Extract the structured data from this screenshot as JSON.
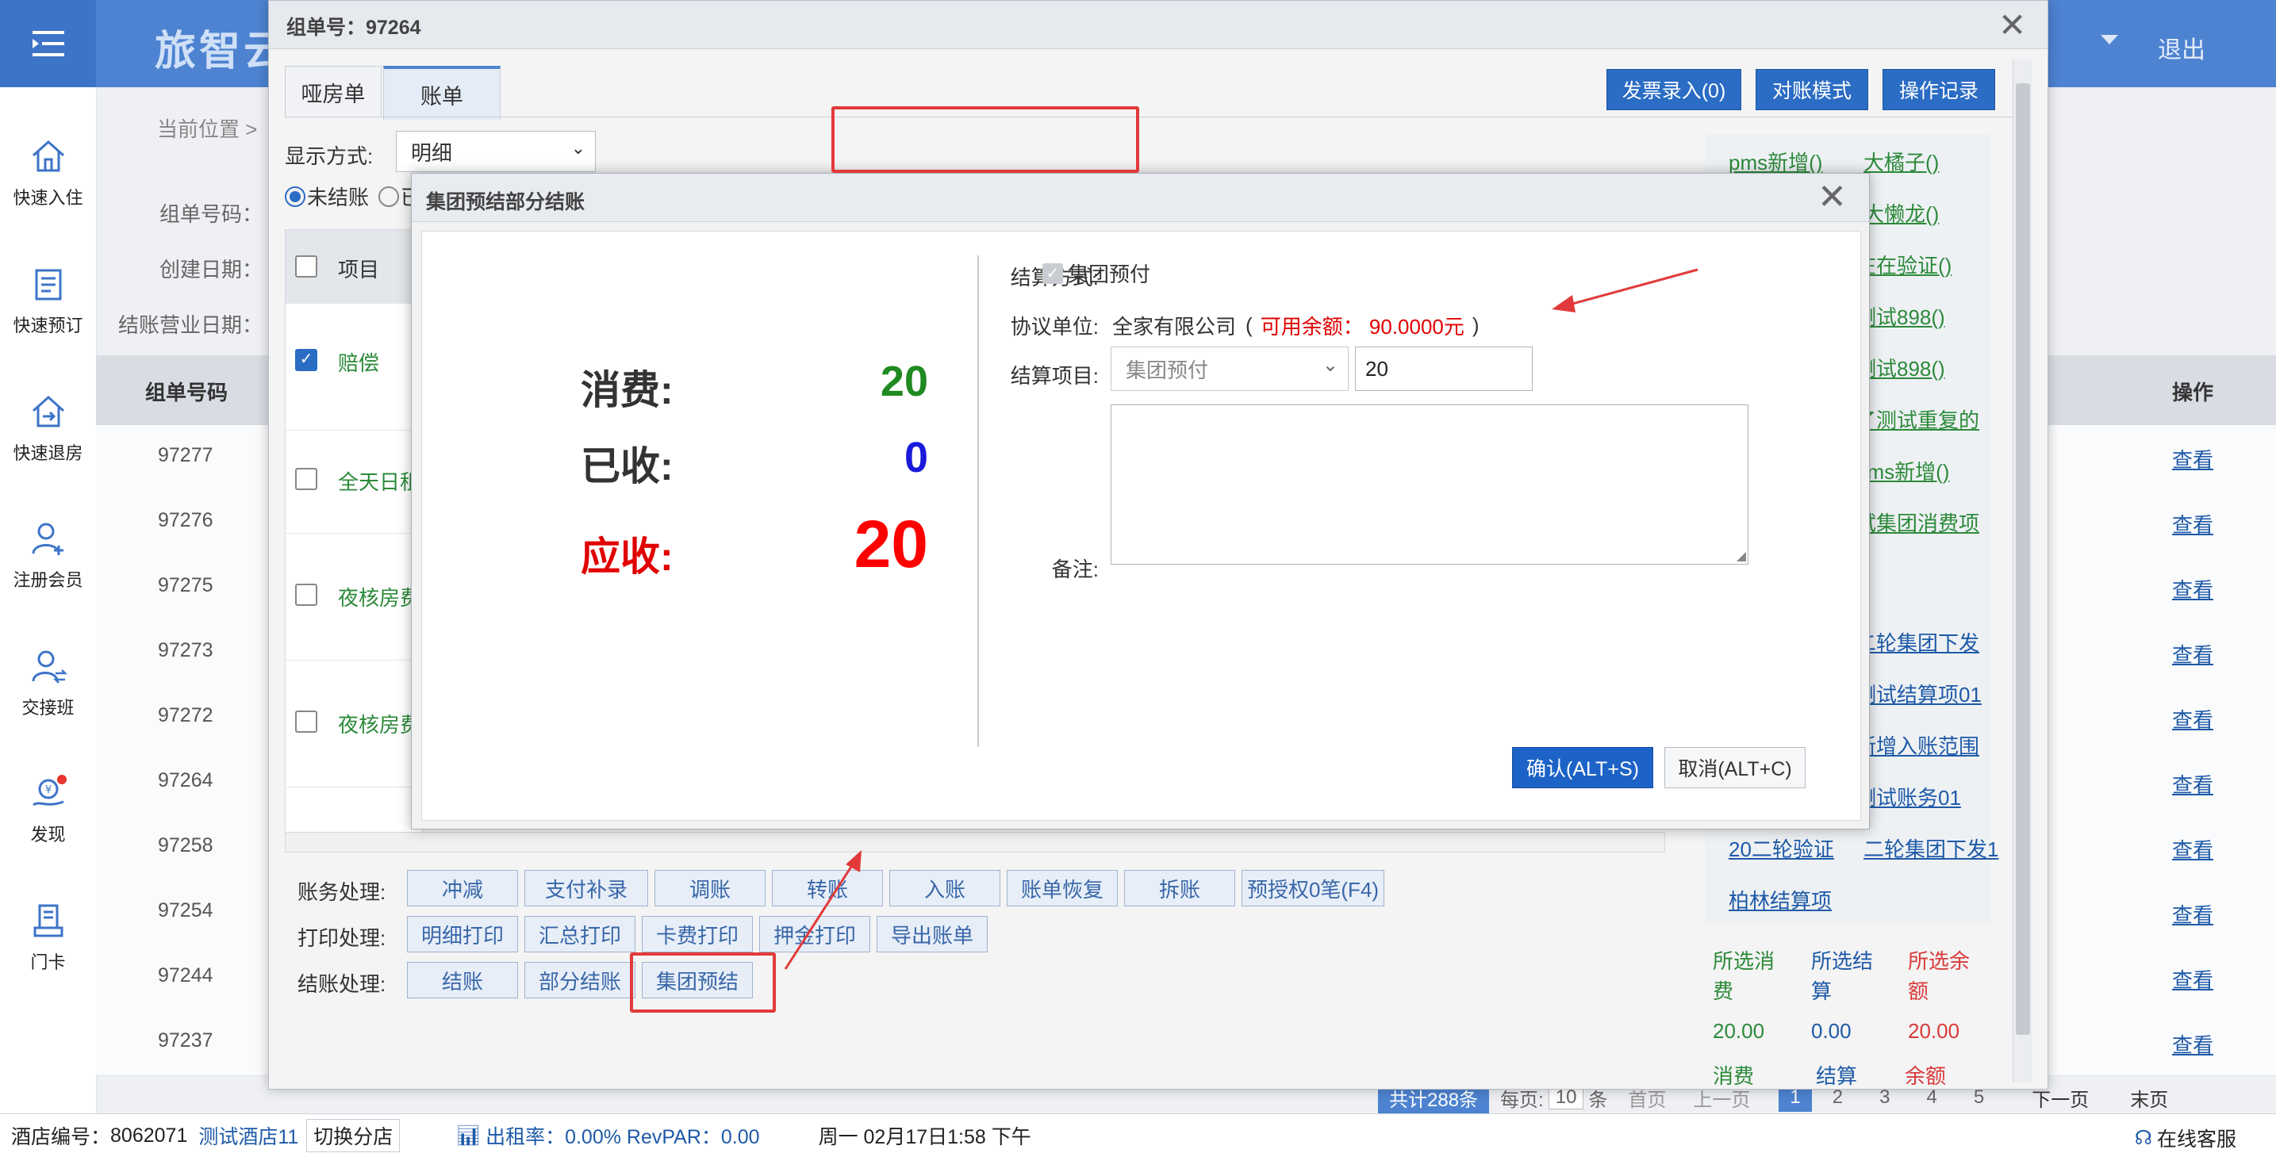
{
  "app": {
    "title": "旅智云",
    "logout": "退出"
  },
  "sidebar": {
    "items": [
      {
        "label": "快速入住"
      },
      {
        "label": "快速预订"
      },
      {
        "label": "快速退房"
      },
      {
        "label": "注册会员"
      },
      {
        "label": "交接班"
      },
      {
        "label": "发现"
      },
      {
        "label": "门卡"
      }
    ]
  },
  "background_page": {
    "breadcrumb": "当前位置 >",
    "labels": [
      "组单号码：",
      "创建日期：",
      "结账营业日期："
    ],
    "col_group_no": "组单号码",
    "col_action": "操作",
    "rows": [
      "97277",
      "97276",
      "97275",
      "97273",
      "97272",
      "97264",
      "97258",
      "97254",
      "97244",
      "97237"
    ],
    "view_label": "查看"
  },
  "pager": {
    "total": "共计288条",
    "per_page_label": "每页:",
    "per_page": "10",
    "records": "条",
    "first": "首页",
    "prev": "上一页",
    "pages": [
      "1",
      "2",
      "3",
      "4",
      "5"
    ],
    "next": "下一页",
    "last": "末页"
  },
  "status": {
    "hotel_no_label": "酒店编号：",
    "hotel_no": "8062071",
    "hotel_name": "测试酒店11",
    "switch": "切换分店",
    "occupancy": "出租率：0.00% RevPAR：0.00",
    "datetime": "周一 02月17日1:58 下午",
    "support": "在线客服"
  },
  "outer_dialog": {
    "title": "组单号：97264",
    "tabs": [
      "哑房单",
      "账单"
    ],
    "toolbar": [
      "发票录入(0)",
      "对账模式",
      "操作记录"
    ],
    "display_label": "显示方式:",
    "display_value": "明细",
    "radio_unsettled": "未结账",
    "radio_settled": "已",
    "item_header": "项目",
    "items": [
      "赔偿",
      "全天日租",
      "夜核房费",
      "夜核房费"
    ],
    "account_label": "账务处理:",
    "account_buttons": [
      "冲减",
      "支付补录",
      "调账",
      "转账",
      "入账",
      "账单恢复",
      "拆账",
      "预授权0笔(F4)"
    ],
    "print_label": "打印处理:",
    "print_buttons": [
      "明细打印",
      "汇总打印",
      "卡费打印",
      "押金打印",
      "导出账单"
    ],
    "checkout_label": "结账处理:",
    "checkout_buttons": [
      "结账",
      "部分结账",
      "集团预结"
    ],
    "links_left": [
      "pms新增()",
      "",
      "",
      "",
      "",
      "",
      "",
      "",
      "",
      "",
      "",
      "",
      "",
      "20二轮验证",
      "柏林结算项"
    ],
    "links_green": [
      "大橘子()",
      "大懒龙()",
      "在在验证()",
      "测试898()",
      "测试898()",
      "了测试重复的",
      "pms新增()",
      "试集团消费项"
    ],
    "links_blue": [
      "二轮集团下发",
      "测试结算项01",
      "新增入账范围",
      "测试账务01",
      "二轮集团下发1"
    ],
    "summary": {
      "sel_consume": "所选消费",
      "sel_settle": "所选结算",
      "sel_balance": "所选余额",
      "sel_consume_val": "20.00",
      "sel_settle_val": "0.00",
      "sel_balance_val": "20.00",
      "consume": "消费",
      "settle": "结算",
      "balance": "余额"
    }
  },
  "inner_dialog": {
    "title": "集团预结部分结账",
    "consume_label": "消费:",
    "consume_value": "20",
    "received_label": "已收:",
    "received_value": "0",
    "due_label": "应收:",
    "due_value": "20",
    "method_label": "结算方式:",
    "method_value": "集团预付",
    "unit_label": "协议单位:",
    "unit_value": "全家有限公司",
    "balance_open": "(",
    "balance_text": "可用余额：  90.0000元",
    "balance_close": ")",
    "item_label": "结算项目:",
    "item_select": "集团预付",
    "item_amount": "20",
    "remark_label": "备注:",
    "confirm": "确认(ALT+S)",
    "cancel": "取消(ALT+C)"
  },
  "colors": {
    "brand": "#4d83d1",
    "green": "#1f8a1f",
    "blue": "#1a1adc",
    "red": "#ff0000",
    "annotation": "#e23a3a"
  }
}
